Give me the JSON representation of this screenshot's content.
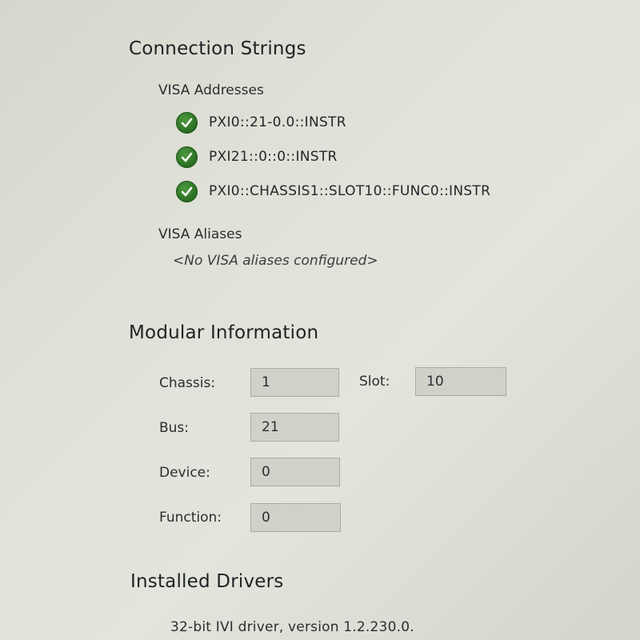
{
  "connection_strings": {
    "title": "Connection Strings",
    "visa_addresses": {
      "title": "VISA Addresses",
      "items": [
        {
          "text": "PXI0::21-0.0::INSTR",
          "status_icon": "check-circle-icon"
        },
        {
          "text": "PXI21::0::0::INSTR",
          "status_icon": "check-circle-icon"
        },
        {
          "text": "PXI0::CHASSIS1::SLOT10::FUNC0::INSTR",
          "status_icon": "check-circle-icon"
        }
      ]
    },
    "visa_aliases": {
      "title": "VISA Aliases",
      "empty_text": "<No VISA aliases configured>"
    }
  },
  "modular_information": {
    "title": "Modular Information",
    "chassis": {
      "label": "Chassis:",
      "value": "1"
    },
    "slot": {
      "label": "Slot:",
      "value": "10"
    },
    "bus": {
      "label": "Bus:",
      "value": "21"
    },
    "device": {
      "label": "Device:",
      "value": "0"
    },
    "function": {
      "label": "Function:",
      "value": "0"
    }
  },
  "installed_drivers": {
    "title": "Installed Drivers",
    "items": [
      "32-bit IVI driver, version 1.2.230.0."
    ]
  },
  "colors": {
    "status_ok": "#2e7426",
    "field_background": "#d0d2ca",
    "panel_background": "#dfe2d8"
  }
}
